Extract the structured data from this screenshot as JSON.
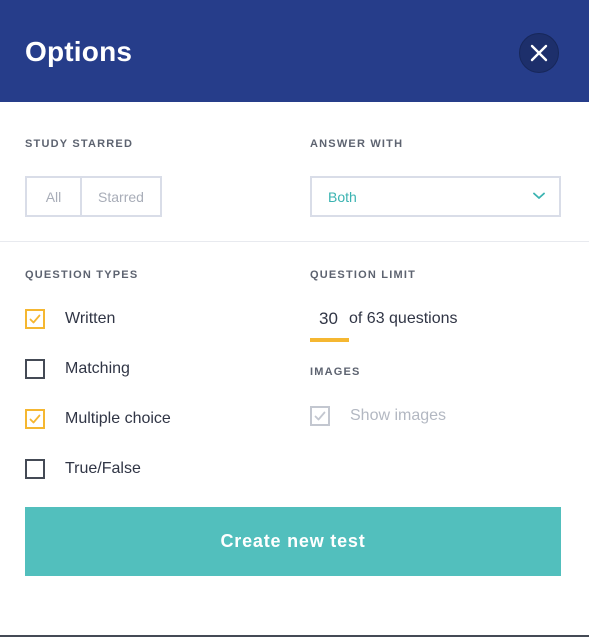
{
  "header": {
    "title": "Options",
    "close_icon": "close-icon"
  },
  "study_starred": {
    "label": "STUDY STARRED",
    "options": [
      "All",
      "Starred"
    ]
  },
  "answer_with": {
    "label": "ANSWER WITH",
    "selected": "Both",
    "icon": "chevron-down-icon"
  },
  "question_types": {
    "label": "QUESTION TYPES",
    "items": [
      {
        "label": "Written",
        "checked": true
      },
      {
        "label": "Matching",
        "checked": false
      },
      {
        "label": "Multiple choice",
        "checked": true
      },
      {
        "label": "True/False",
        "checked": false
      }
    ]
  },
  "question_limit": {
    "label": "QUESTION LIMIT",
    "value": "30",
    "suffix": "of 63 questions"
  },
  "images": {
    "label": "IMAGES",
    "show_images_label": "Show images",
    "checked": true,
    "disabled": true
  },
  "actions": {
    "create_label": "Create new test"
  },
  "colors": {
    "header_bg": "#263d8a",
    "accent_teal": "#52bfbd",
    "checkbox_checked": "#f5b731"
  }
}
